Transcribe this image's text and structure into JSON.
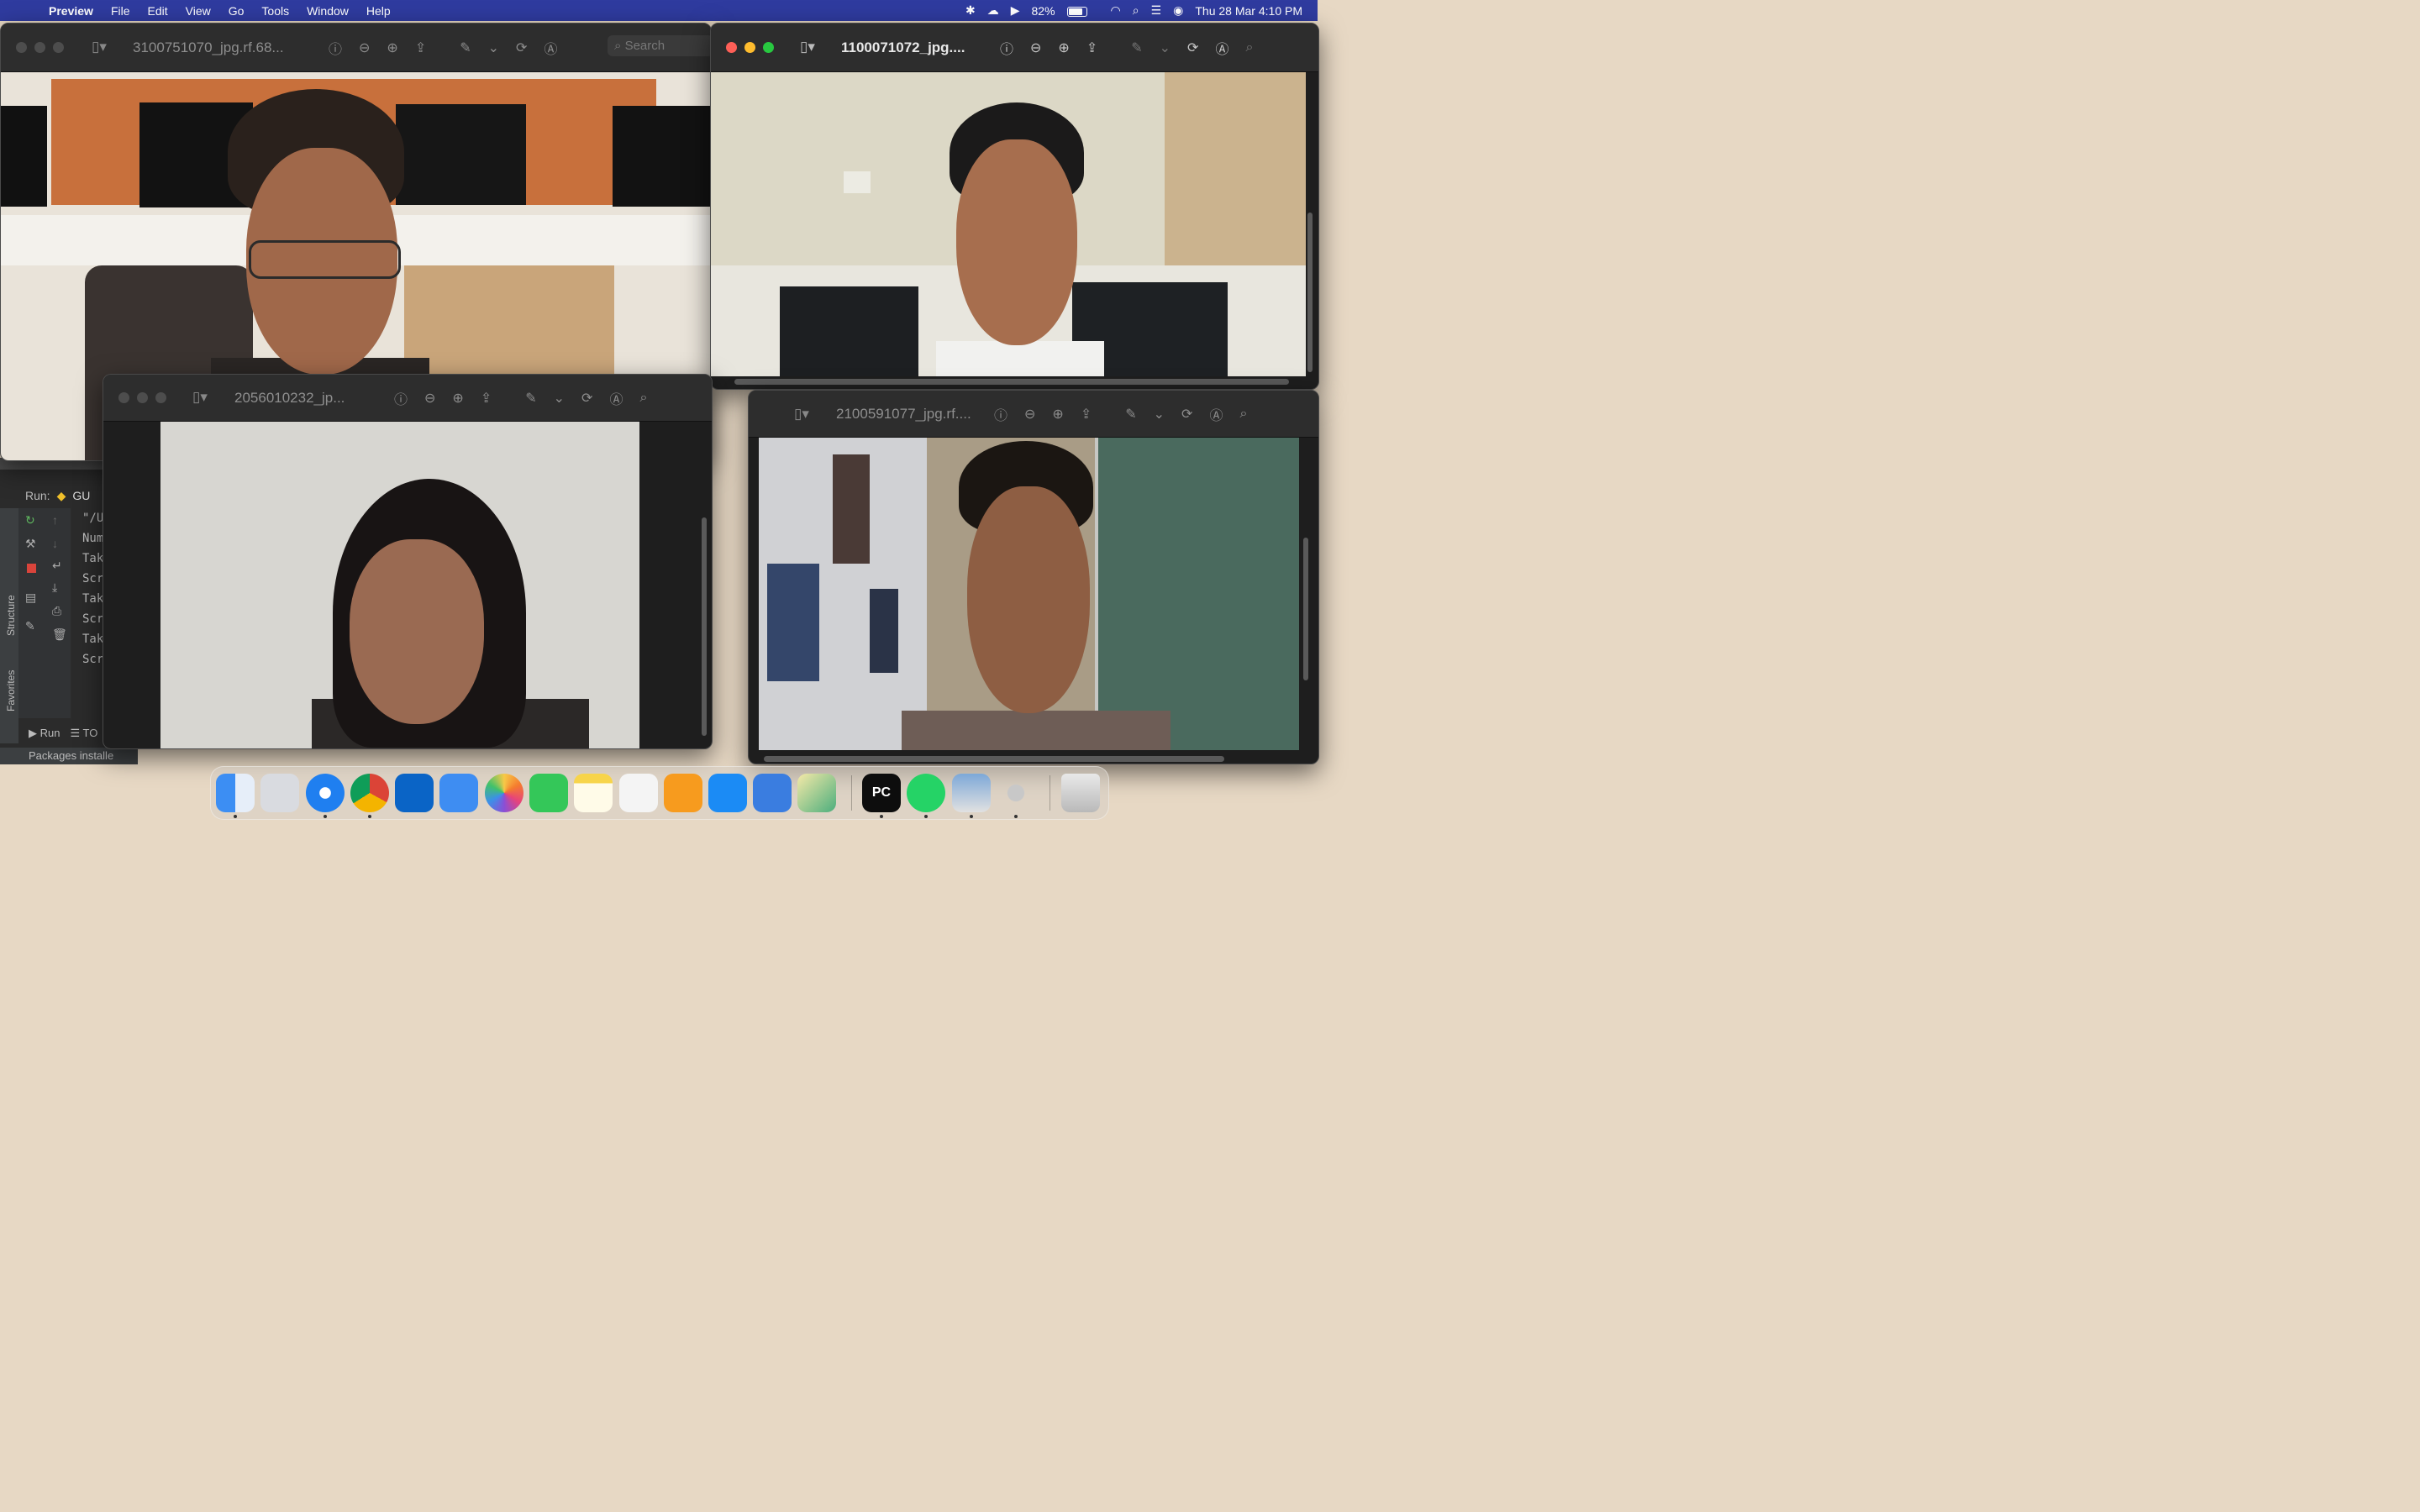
{
  "menubar": {
    "app_name": "Preview",
    "menus": [
      "File",
      "Edit",
      "View",
      "Go",
      "Tools",
      "Window",
      "Help"
    ],
    "battery": "82%",
    "datetime": "Thu 28 Mar  4:10 PM"
  },
  "windows": {
    "w1": {
      "title": "3100751070_jpg.rf.68...",
      "search_placeholder": "Search"
    },
    "w2": {
      "title": "1100071072_jpg...."
    },
    "w3": {
      "title": "2056010232_jp..."
    },
    "w4": {
      "title": "2100591077_jpg.rf...."
    }
  },
  "pycharm": {
    "run_label": "Run:",
    "run_config": "GU",
    "console_lines": [
      "\"/U",
      "Num",
      "Tak",
      "Scr",
      "Tak",
      "Scr",
      "Tak",
      "Scr"
    ],
    "side_tabs": {
      "structure": "Structure",
      "favorites": "Favorites"
    },
    "bottom_tabs": {
      "run": "Run",
      "todo": "TO"
    },
    "status": "Packages installe"
  },
  "dock": {
    "apps": [
      "finder-icon",
      "launchpad-icon",
      "safari-icon",
      "chrome-icon",
      "outlook-icon",
      "mail-icon",
      "photos-icon",
      "facetime-icon",
      "notes-icon",
      "textedit-icon",
      "pages-icon",
      "app-store-icon",
      "xcode-icon",
      "box-app-icon",
      "pycharm-icon",
      "whatsapp-icon",
      "preview-icon",
      "rocket-icon",
      "trash-icon"
    ],
    "pycharm_label": "PC"
  },
  "colors": {
    "menubar": "#2f3b9f",
    "window_bg": "#1e1e1e",
    "toolbar": "#2d2d2d",
    "close": "#fe5f57",
    "minimize": "#febc2e",
    "zoom": "#28c840"
  }
}
